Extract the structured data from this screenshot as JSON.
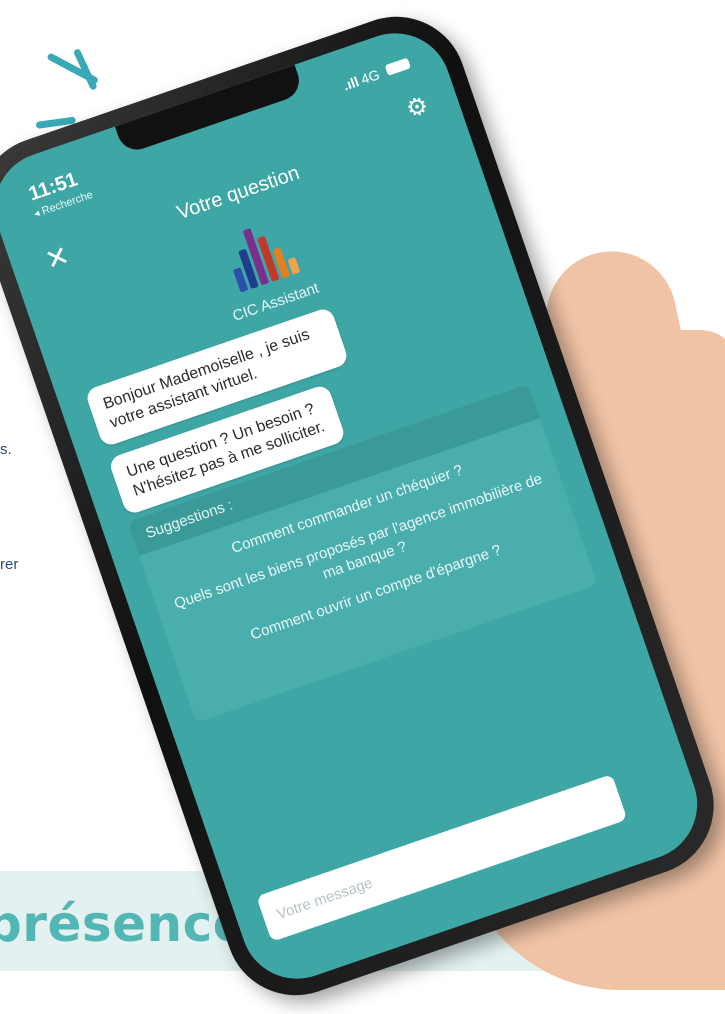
{
  "left_fragments": {
    "line1": "s.",
    "line2": "rer"
  },
  "bottom_heading": "présence",
  "status_bar": {
    "time": "11:51",
    "back_label": "◂ Recherche",
    "signal": ".ıll",
    "network": "4G"
  },
  "header": {
    "title": "Votre question"
  },
  "assistant": {
    "name": "CIC Assistant"
  },
  "messages": [
    {
      "text": "Bonjour Mademoiselle          , je suis votre assistant virtuel."
    },
    {
      "text": "Une question ? Un besoin ? N'hésitez pas à me solliciter."
    }
  ],
  "suggestions": {
    "label": "Suggestions :",
    "items": [
      "Comment commander un chéquier ?",
      "Quels sont les biens proposés par l'agence immobilière de ma banque ?",
      "Comment ouvrir un compte d'épargne ?"
    ]
  },
  "composer": {
    "placeholder": "Votre message"
  },
  "icons": {
    "settings": "gear-icon",
    "close": "close-icon",
    "send": "send-icon"
  },
  "colors": {
    "screen_teal": "#3ea7a6",
    "heading_teal": "#52b6b4",
    "text_blue": "#2a4a7a"
  }
}
